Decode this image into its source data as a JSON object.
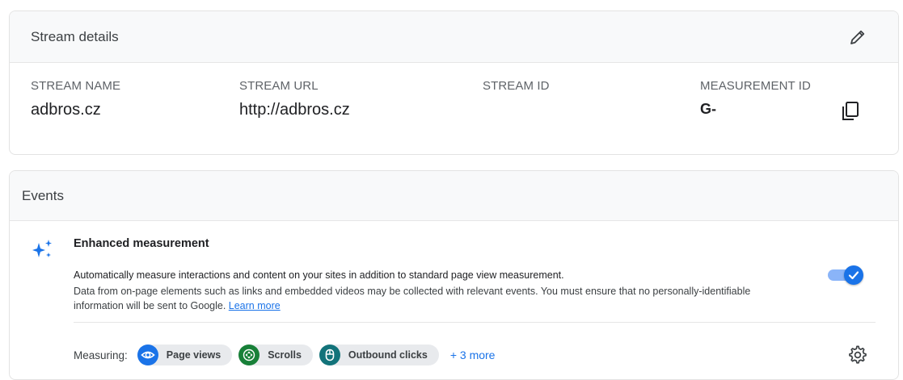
{
  "stream_card": {
    "title": "Stream details",
    "fields": [
      {
        "label": "STREAM NAME",
        "value": "adbros.cz"
      },
      {
        "label": "STREAM URL",
        "value": "http://adbros.cz"
      },
      {
        "label": "STREAM ID",
        "value": ""
      },
      {
        "label": "MEASUREMENT ID",
        "value": "G-"
      }
    ]
  },
  "events_card": {
    "title": "Events",
    "enhanced": {
      "title": "Enhanced measurement",
      "desc_line1": "Automatically measure interactions and content on your sites in addition to standard page view measurement.",
      "desc_line2": "Data from on-page elements such as links and embedded videos may be collected with relevant events. You must ensure that no personally-identifiable information will be sent to Google.",
      "learn_more": "Learn more",
      "enabled": true
    },
    "measuring": {
      "label": "Measuring:",
      "chips": [
        {
          "label": "Page views",
          "icon": "eye-icon",
          "color": "#1a73e8"
        },
        {
          "label": "Scrolls",
          "icon": "scroll-arrows-icon",
          "color": "#188038"
        },
        {
          "label": "Outbound clicks",
          "icon": "mouse-icon",
          "color": "#12737a"
        }
      ],
      "more": "+ 3 more"
    }
  },
  "colors": {
    "accent": "#1a73e8",
    "header_bg": "#f8f9fa",
    "chip_bg": "#e8eaed"
  }
}
